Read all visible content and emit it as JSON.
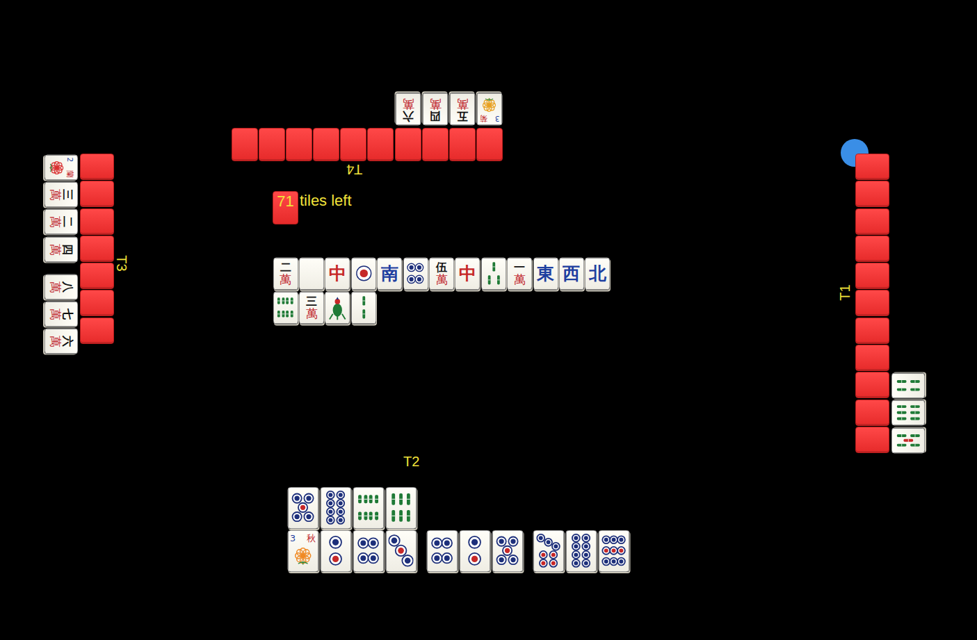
{
  "wall": {
    "count": "71",
    "label": "tiles left"
  },
  "opponents": {
    "top": {
      "name": "T4",
      "dealer": false,
      "concealed": 10,
      "melds": [
        [
          {
            "kind": "character",
            "number": "六",
            "suit": "萬"
          },
          {
            "kind": "character",
            "number": "四",
            "suit": "萬"
          },
          {
            "kind": "character",
            "number": "五",
            "suit": "萬"
          },
          {
            "kind": "flower",
            "number": "3",
            "name": "菊",
            "color": "#e8a020"
          }
        ]
      ]
    },
    "left": {
      "name": "T3",
      "dealer": false,
      "concealed": 7,
      "melds": [
        [
          {
            "kind": "flower",
            "number": "2",
            "name": "蘭",
            "color": "#d93030"
          },
          {
            "kind": "character",
            "number": "三",
            "suit": "萬"
          },
          {
            "kind": "character",
            "number": "二",
            "suit": "萬"
          },
          {
            "kind": "character",
            "number": "四",
            "suit": "萬"
          }
        ],
        [
          {
            "kind": "character",
            "number": "八",
            "suit": "萬"
          },
          {
            "kind": "character",
            "number": "七",
            "suit": "萬"
          },
          {
            "kind": "character",
            "number": "六",
            "suit": "萬"
          }
        ]
      ]
    },
    "right": {
      "name": "T1",
      "dealer": true,
      "concealed": 11,
      "melds": [
        [
          {
            "kind": "bamboo",
            "count": 4
          },
          {
            "kind": "bamboo",
            "count": 6
          },
          {
            "kind": "bamboo",
            "count": 5
          }
        ]
      ]
    }
  },
  "discards": [
    {
      "kind": "character",
      "number": "二",
      "suit": "萬"
    },
    {
      "kind": "blank"
    },
    {
      "kind": "honor",
      "char": "中",
      "color": "#c62828"
    },
    {
      "kind": "dots",
      "count": 1
    },
    {
      "kind": "honor",
      "char": "南",
      "color": "#1e3fa0"
    },
    {
      "kind": "dots",
      "count": 4
    },
    {
      "kind": "character",
      "number": "伍",
      "suit": "萬"
    },
    {
      "kind": "honor",
      "char": "中",
      "color": "#c62828"
    },
    {
      "kind": "bamboo",
      "count": 3
    },
    {
      "kind": "character",
      "number": "一",
      "suit": "萬"
    },
    {
      "kind": "honor",
      "char": "東",
      "color": "#1e3fa0"
    },
    {
      "kind": "honor",
      "char": "西",
      "color": "#1e3fa0"
    },
    {
      "kind": "honor",
      "char": "北",
      "color": "#1e3fa0"
    },
    {
      "kind": "bamboo",
      "count": 8
    },
    {
      "kind": "character",
      "number": "三",
      "suit": "萬"
    },
    {
      "kind": "bamboo",
      "count": 1
    },
    {
      "kind": "bamboo",
      "count": 2
    }
  ],
  "player": {
    "name": "T2",
    "dealer": false,
    "exposed": [
      {
        "kind": "dots",
        "count": 5
      },
      {
        "kind": "dots",
        "count": 8
      },
      {
        "kind": "bamboo",
        "count": 8
      },
      {
        "kind": "bamboo",
        "count": 6
      }
    ],
    "hand": [
      [
        {
          "kind": "flower",
          "number": "3",
          "name": "秋",
          "color": "#f08a24"
        },
        {
          "kind": "dots",
          "count": 2
        },
        {
          "kind": "dots",
          "count": 4
        },
        {
          "kind": "dots",
          "count": 3
        }
      ],
      [
        {
          "kind": "dots",
          "count": 4
        },
        {
          "kind": "dots",
          "count": 2
        },
        {
          "kind": "dots",
          "count": 5
        }
      ],
      [
        {
          "kind": "dots",
          "count": 7
        },
        {
          "kind": "dots",
          "count": 8
        },
        {
          "kind": "dots",
          "count": 9
        }
      ]
    ]
  }
}
